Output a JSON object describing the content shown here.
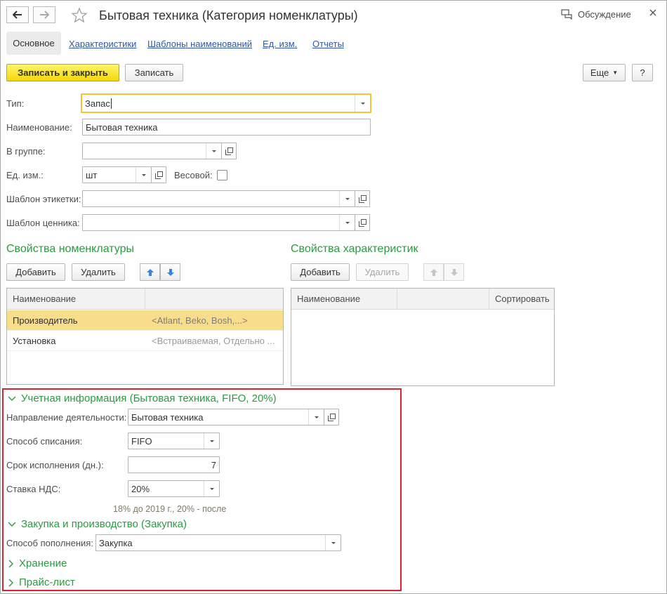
{
  "window": {
    "title": "Бытовая техника (Категория номенклатуры)",
    "discussion_label": "Обсуждение"
  },
  "tabs": [
    {
      "label": "Основное",
      "active": true
    },
    {
      "label": "Характеристики"
    },
    {
      "label": "Шаблоны наименований"
    },
    {
      "label": "Ед. изм."
    },
    {
      "label": "Отчеты"
    }
  ],
  "toolbar": {
    "save_close_label": "Записать и закрыть",
    "save_label": "Записать",
    "more_label": "Еще",
    "help_label": "?"
  },
  "form": {
    "type_label": "Тип:",
    "type_value": "Запас",
    "name_label": "Наименование:",
    "name_value": "Бытовая техника",
    "group_label": "В группе:",
    "group_value": "",
    "unit_label": "Ед. изм.:",
    "unit_value": "шт",
    "weight_label": "Весовой:",
    "weight_checked": false,
    "label_template_label": "Шаблон этикетки:",
    "label_template_value": "",
    "price_template_label": "Шаблон ценника:",
    "price_template_value": ""
  },
  "item_props": {
    "title": "Свойства номенклатуры",
    "add_label": "Добавить",
    "delete_label": "Удалить",
    "columns": [
      "Наименование",
      ""
    ],
    "rows": [
      {
        "name": "Производитель",
        "values": "<Atlant, Beko, Bosh,...>",
        "selected": true
      },
      {
        "name": "Установка",
        "values": "<Встраиваемая, Отдельно ...",
        "selected": false
      }
    ]
  },
  "char_props": {
    "title": "Свойства характеристик",
    "add_label": "Добавить",
    "delete_label": "Удалить",
    "columns": [
      "Наименование",
      "",
      "Сортировать"
    ],
    "rows": []
  },
  "accounting": {
    "title": "Учетная информация (Бытовая техника, FIFO, 20%)",
    "activity_label": "Направление деятельности:",
    "activity_value": "Бытовая техника",
    "writeoff_label": "Способ списания:",
    "writeoff_value": "FIFO",
    "term_label": "Срок исполнения (дн.):",
    "term_value": "7",
    "vat_label": "Ставка НДС:",
    "vat_value": "20%",
    "vat_hint": "18% до 2019 г., 20% - после"
  },
  "purchase": {
    "title": "Закупка и производство (Закупка)",
    "replenish_label": "Способ пополнения:",
    "replenish_value": "Закупка"
  },
  "storage": {
    "title": "Хранение"
  },
  "pricelist": {
    "title": "Прайс-лист"
  },
  "colors": {
    "accent_green": "#2b9a41",
    "link_blue": "#2d58a4",
    "primary_yellow": "#f3d80c",
    "selected_row": "#f8dd8a",
    "highlight_red": "#d9232e",
    "focus_border": "#f5c42e"
  },
  "icons": {
    "back": "arrow-left-icon",
    "forward": "arrow-right-icon",
    "favorite": "star-icon",
    "discussion": "chat-bubbles-icon",
    "close": "close-icon",
    "dropdown": "chevron-down-icon",
    "open": "open-window-icon",
    "move_up": "arrow-up-icon",
    "move_down": "arrow-down-icon",
    "expanded": "chevron-down-icon",
    "collapsed": "chevron-right-icon"
  }
}
